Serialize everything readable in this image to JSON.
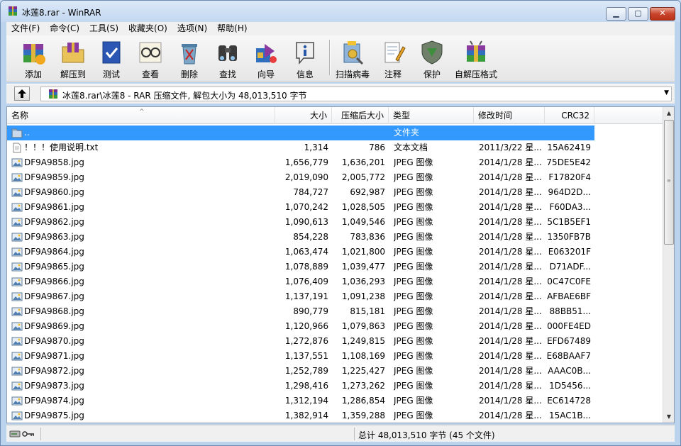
{
  "window": {
    "title": "冰莲8.rar - WinRAR",
    "buttons": {
      "minimize": "▁",
      "maximize": "▢",
      "close": "✕"
    }
  },
  "menu": [
    "文件(F)",
    "命令(C)",
    "工具(S)",
    "收藏夹(O)",
    "选项(N)",
    "帮助(H)"
  ],
  "toolbar": [
    {
      "label": "添加",
      "icon": "add-archive-icon"
    },
    {
      "label": "解压到",
      "icon": "extract-to-icon"
    },
    {
      "label": "测试",
      "icon": "test-icon"
    },
    {
      "label": "查看",
      "icon": "view-icon"
    },
    {
      "label": "删除",
      "icon": "delete-icon"
    },
    {
      "label": "查找",
      "icon": "find-icon"
    },
    {
      "label": "向导",
      "icon": "wizard-icon"
    },
    {
      "label": "信息",
      "icon": "info-icon"
    },
    {
      "label": "扫描病毒",
      "icon": "virus-scan-icon"
    },
    {
      "label": "注释",
      "icon": "comment-icon"
    },
    {
      "label": "保护",
      "icon": "protect-icon"
    },
    {
      "label": "自解压格式",
      "icon": "sfx-icon"
    }
  ],
  "address": {
    "text": "冰莲8.rar\\冰莲8 - RAR 压缩文件, 解包大小为 48,013,510 字节"
  },
  "columns": {
    "name": "名称",
    "size": "大小",
    "packed": "压缩后大小",
    "type": "类型",
    "modified": "修改时间",
    "crc": "CRC32"
  },
  "files": [
    {
      "name": "..",
      "size": "",
      "packed": "",
      "type": "文件夹",
      "modified": "",
      "crc": "",
      "kind": "folder",
      "selected": true
    },
    {
      "name": "！！！使用说明.txt",
      "size": "1,314",
      "packed": "786",
      "type": "文本文档",
      "modified": "2011/3/22 星...",
      "crc": "15A62419",
      "kind": "txt"
    },
    {
      "name": "DF9A9858.jpg",
      "size": "1,656,779",
      "packed": "1,636,201",
      "type": "JPEG 图像",
      "modified": "2014/1/28 星...",
      "crc": "75DE5E42",
      "kind": "jpg"
    },
    {
      "name": "DF9A9859.jpg",
      "size": "2,019,090",
      "packed": "2,005,772",
      "type": "JPEG 图像",
      "modified": "2014/1/28 星...",
      "crc": "F17820F4",
      "kind": "jpg"
    },
    {
      "name": "DF9A9860.jpg",
      "size": "784,727",
      "packed": "692,987",
      "type": "JPEG 图像",
      "modified": "2014/1/28 星...",
      "crc": "964D2D...",
      "kind": "jpg"
    },
    {
      "name": "DF9A9861.jpg",
      "size": "1,070,242",
      "packed": "1,028,505",
      "type": "JPEG 图像",
      "modified": "2014/1/28 星...",
      "crc": "F60DA3...",
      "kind": "jpg"
    },
    {
      "name": "DF9A9862.jpg",
      "size": "1,090,613",
      "packed": "1,049,546",
      "type": "JPEG 图像",
      "modified": "2014/1/28 星...",
      "crc": "5C1B5EF1",
      "kind": "jpg"
    },
    {
      "name": "DF9A9863.jpg",
      "size": "854,228",
      "packed": "783,836",
      "type": "JPEG 图像",
      "modified": "2014/1/28 星...",
      "crc": "1350FB7B",
      "kind": "jpg"
    },
    {
      "name": "DF9A9864.jpg",
      "size": "1,063,474",
      "packed": "1,021,800",
      "type": "JPEG 图像",
      "modified": "2014/1/28 星...",
      "crc": "E063201F",
      "kind": "jpg"
    },
    {
      "name": "DF9A9865.jpg",
      "size": "1,078,889",
      "packed": "1,039,477",
      "type": "JPEG 图像",
      "modified": "2014/1/28 星...",
      "crc": "D71ADF...",
      "kind": "jpg"
    },
    {
      "name": "DF9A9866.jpg",
      "size": "1,076,409",
      "packed": "1,036,293",
      "type": "JPEG 图像",
      "modified": "2014/1/28 星...",
      "crc": "0C47C0FE",
      "kind": "jpg"
    },
    {
      "name": "DF9A9867.jpg",
      "size": "1,137,191",
      "packed": "1,091,238",
      "type": "JPEG 图像",
      "modified": "2014/1/28 星...",
      "crc": "AFBAE6BF",
      "kind": "jpg"
    },
    {
      "name": "DF9A9868.jpg",
      "size": "890,779",
      "packed": "815,181",
      "type": "JPEG 图像",
      "modified": "2014/1/28 星...",
      "crc": "88BB51...",
      "kind": "jpg"
    },
    {
      "name": "DF9A9869.jpg",
      "size": "1,120,966",
      "packed": "1,079,863",
      "type": "JPEG 图像",
      "modified": "2014/1/28 星...",
      "crc": "000FE4ED",
      "kind": "jpg"
    },
    {
      "name": "DF9A9870.jpg",
      "size": "1,272,876",
      "packed": "1,249,815",
      "type": "JPEG 图像",
      "modified": "2014/1/28 星...",
      "crc": "EFD67489",
      "kind": "jpg"
    },
    {
      "name": "DF9A9871.jpg",
      "size": "1,137,551",
      "packed": "1,108,169",
      "type": "JPEG 图像",
      "modified": "2014/1/28 星...",
      "crc": "E68BAAF7",
      "kind": "jpg"
    },
    {
      "name": "DF9A9872.jpg",
      "size": "1,252,789",
      "packed": "1,225,427",
      "type": "JPEG 图像",
      "modified": "2014/1/28 星...",
      "crc": "AAAC0B...",
      "kind": "jpg"
    },
    {
      "name": "DF9A9873.jpg",
      "size": "1,298,416",
      "packed": "1,273,262",
      "type": "JPEG 图像",
      "modified": "2014/1/28 星...",
      "crc": "1D5456...",
      "kind": "jpg"
    },
    {
      "name": "DF9A9874.jpg",
      "size": "1,312,194",
      "packed": "1,286,854",
      "type": "JPEG 图像",
      "modified": "2014/1/28 星...",
      "crc": "EC614728",
      "kind": "jpg"
    },
    {
      "name": "DF9A9875.jpg",
      "size": "1,382,914",
      "packed": "1,359,288",
      "type": "JPEG 图像",
      "modified": "2014/1/28 星...",
      "crc": "15AC1B...",
      "kind": "jpg"
    }
  ],
  "status": {
    "total": "总计 48,013,510 字节 (45 个文件)"
  },
  "colors": {
    "selection": "#3399ff",
    "title_gradient_top": "#dbe8f8",
    "close_button": "#c9452c"
  }
}
